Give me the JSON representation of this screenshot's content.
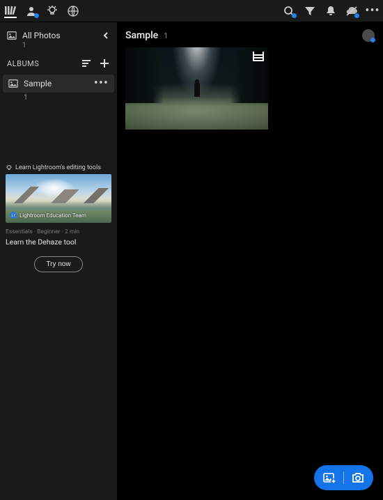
{
  "topbar": {
    "icons_left": [
      "library",
      "people",
      "learn",
      "web"
    ],
    "icons_right": [
      "search",
      "filter",
      "bell",
      "cloud-off",
      "more"
    ]
  },
  "sidebar": {
    "all_photos_label": "All Photos",
    "all_photos_count": "1",
    "albums_header": "ALBUMS",
    "album": {
      "name": "Sample",
      "count": "1"
    }
  },
  "promo": {
    "header": "Learn Lightroom's editing tools",
    "author": "Lightroom Education Team",
    "meta": "Essentials · Beginner · 2 min",
    "title": "Learn the Dehaze tool",
    "button": "Try now"
  },
  "main": {
    "title": "Sample",
    "count": "1"
  },
  "fab": {
    "add_label": "add-photos",
    "camera_label": "camera"
  },
  "colors": {
    "accent": "#1473e6"
  }
}
